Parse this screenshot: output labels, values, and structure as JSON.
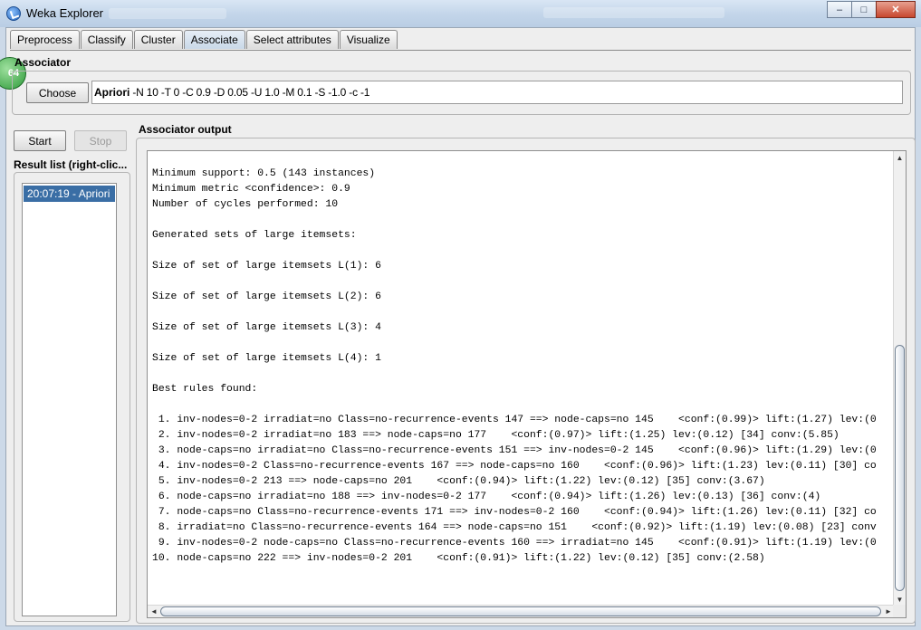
{
  "window": {
    "title": "Weka Explorer",
    "controls": {
      "minimize": "–",
      "maximize": "□",
      "close": "✕"
    }
  },
  "tabs": [
    {
      "label": "Preprocess",
      "active": false
    },
    {
      "label": "Classify",
      "active": false
    },
    {
      "label": "Cluster",
      "active": false
    },
    {
      "label": "Associate",
      "active": true
    },
    {
      "label": "Select attributes",
      "active": false
    },
    {
      "label": "Visualize",
      "active": false
    }
  ],
  "badge_text": "64",
  "associator": {
    "section_label": "Associator",
    "choose_label": "Choose",
    "scheme_name": "Apriori",
    "scheme_options": "-N 10 -T 0 -C 0.9 -D 0.05 -U 1.0 -M 0.1 -S -1.0 -c -1"
  },
  "controls": {
    "start_label": "Start",
    "stop_label": "Stop"
  },
  "results": {
    "label": "Result list (right-clic...",
    "items": [
      {
        "label": "20:07:19 - Apriori",
        "selected": true
      }
    ]
  },
  "output": {
    "label": "Associator output",
    "lines": [
      "Minimum support: 0.5 (143 instances)",
      "Minimum metric <confidence>: 0.9",
      "Number of cycles performed: 10",
      "",
      "Generated sets of large itemsets:",
      "",
      "Size of set of large itemsets L(1): 6",
      "",
      "Size of set of large itemsets L(2): 6",
      "",
      "Size of set of large itemsets L(3): 4",
      "",
      "Size of set of large itemsets L(4): 1",
      "",
      "Best rules found:",
      "",
      " 1. inv-nodes=0-2 irradiat=no Class=no-recurrence-events 147 ==> node-caps=no 145    <conf:(0.99)> lift:(1.27) lev:(0",
      " 2. inv-nodes=0-2 irradiat=no 183 ==> node-caps=no 177    <conf:(0.97)> lift:(1.25) lev:(0.12) [34] conv:(5.85)",
      " 3. node-caps=no irradiat=no Class=no-recurrence-events 151 ==> inv-nodes=0-2 145    <conf:(0.96)> lift:(1.29) lev:(0",
      " 4. inv-nodes=0-2 Class=no-recurrence-events 167 ==> node-caps=no 160    <conf:(0.96)> lift:(1.23) lev:(0.11) [30] co",
      " 5. inv-nodes=0-2 213 ==> node-caps=no 201    <conf:(0.94)> lift:(1.22) lev:(0.12) [35] conv:(3.67)",
      " 6. node-caps=no irradiat=no 188 ==> inv-nodes=0-2 177    <conf:(0.94)> lift:(1.26) lev:(0.13) [36] conv:(4)",
      " 7. node-caps=no Class=no-recurrence-events 171 ==> inv-nodes=0-2 160    <conf:(0.94)> lift:(1.26) lev:(0.11) [32] co",
      " 8. irradiat=no Class=no-recurrence-events 164 ==> node-caps=no 151    <conf:(0.92)> lift:(1.19) lev:(0.08) [23] conv",
      " 9. inv-nodes=0-2 node-caps=no Class=no-recurrence-events 160 ==> irradiat=no 145    <conf:(0.91)> lift:(1.19) lev:(0",
      "10. node-caps=no 222 ==> inv-nodes=0-2 201    <conf:(0.91)> lift:(1.22) lev:(0.12) [35] conv:(2.58)"
    ]
  },
  "icons": {
    "app": "weka-bird-icon",
    "scroll_up": "▲",
    "scroll_down": "▼",
    "scroll_left": "◄",
    "scroll_right": "►"
  },
  "colors": {
    "selection": "#3a6ea5",
    "window_frame": "#ccd9e8",
    "panel_bg": "#eeeeee"
  }
}
